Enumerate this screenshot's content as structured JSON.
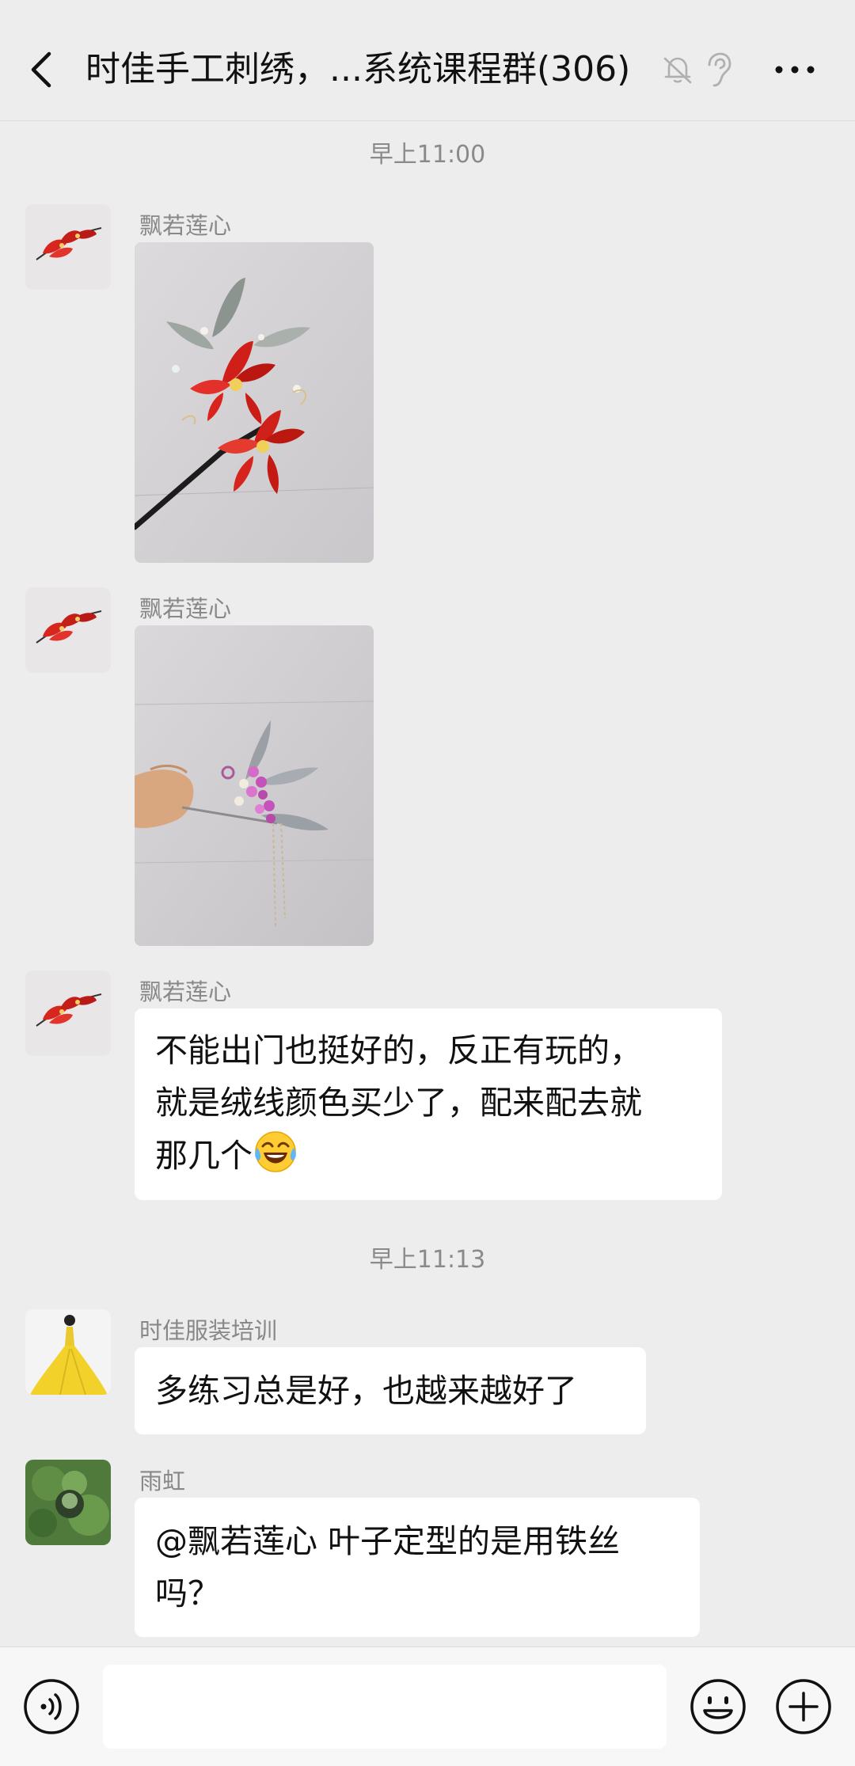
{
  "header": {
    "title": "时佳手工刺绣，...系统课程群(306)",
    "back_icon": "back-chevron-icon",
    "mute_icon": "bell-muted-icon",
    "ear_icon": "earpiece-icon",
    "more_icon": "more-dots-icon"
  },
  "messages": {
    "time_1": "早上11:00",
    "time_2": "早上11:13",
    "m1": {
      "sender": "飘若莲心",
      "type": "image",
      "content": "red flower hairpin photo"
    },
    "m2": {
      "sender": "飘若莲心",
      "type": "image",
      "content": "purple flower hairpin photo"
    },
    "m3": {
      "sender": "飘若莲心",
      "line1": "不能出门也挺好的，反正有玩的，",
      "line2": "就是绒线颜色买少了，配来配去就",
      "line3": "那几个",
      "emoji": "tears-of-joy-emoji"
    },
    "m4": {
      "sender": "时佳服装培训",
      "text": "多练习总是好，也越来越好了"
    },
    "m5": {
      "sender": "雨虹",
      "line1": "@飘若莲心  叶子定型的是用铁丝",
      "line2": "吗？"
    }
  },
  "input_bar": {
    "voice_icon": "voice-input-icon",
    "emoji_icon": "emoji-icon",
    "plus_icon": "plus-icon",
    "message_value": ""
  },
  "colors": {
    "background": "#ededed",
    "bubble": "#ffffff",
    "meta_text": "#8a8a8a"
  }
}
